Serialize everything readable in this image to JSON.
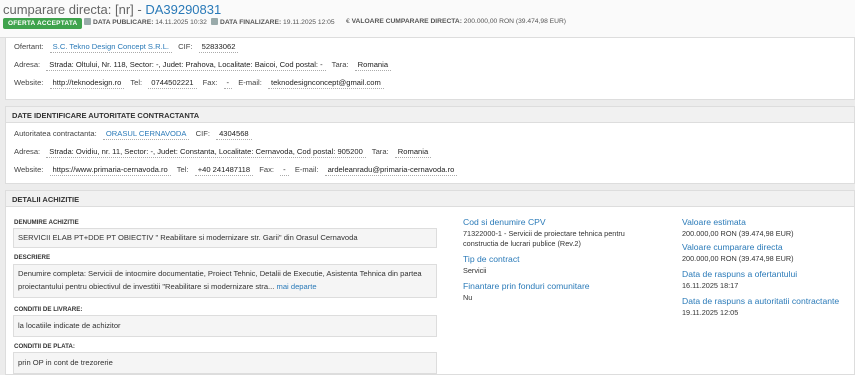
{
  "header": {
    "title_prefix": "cumparare directa: [nr] - ",
    "title_code": "DA39290831",
    "status_badge": "OFERTA ACCEPTATA",
    "publish_label": "DATA PUBLICARE:",
    "publish_value": "14.11.2025 10:32",
    "finalize_label": "DATA FINALIZARE:",
    "finalize_value": "19.11.2025 12:05",
    "value_label": "VALOARE CUMPARARE DIRECTA:",
    "value_value": "200.000,00 RON (39.474,98 EUR)",
    "value_currency_symbol": "€"
  },
  "offerer": {
    "ofertant_label": "Ofertant:",
    "ofertant_value": "S.C. Tekno Design Concept S.R.L.",
    "cif_label": "CIF:",
    "cif_value": "52833062",
    "address_label": "Adresa:",
    "address_value": "Strada: Oltului, Nr. 118, Sector: -, Judet: Prahova, Localitate: Baicoi, Cod postal: -",
    "country_label": "Tara:",
    "country_value": "Romania",
    "website_label": "Website:",
    "website_value": "http://teknodesign.ro",
    "tel_label": "Tel:",
    "tel_value": "0744502221",
    "fax_label": "Fax:",
    "fax_value": "-",
    "email_label": "E-mail:",
    "email_value": "teknodesignconcept@gmail.com"
  },
  "authority": {
    "section_title": "DATE IDENTIFICARE AUTORITATE CONTRACTANTA",
    "name_label": "Autoritatea contractanta:",
    "name_value": "ORASUL CERNAVODA",
    "cif_label": "CIF:",
    "cif_value": "4304568",
    "address_label": "Adresa:",
    "address_value": "Strada: Ovidiu, nr. 11, Sector: -, Judet: Constanta, Localitate: Cernavoda, Cod postal: 905200",
    "country_label": "Tara:",
    "country_value": "Romania",
    "website_label": "Website:",
    "website_value": "https://www.primaria-cernavoda.ro",
    "tel_label": "Tel:",
    "tel_value": "+40 241487118",
    "fax_label": "Fax:",
    "fax_value": "-",
    "email_label": "E-mail:",
    "email_value": "ardeleanradu@primaria-cernavoda.ro"
  },
  "details": {
    "section_title": "DETALII ACHIZITIE",
    "denumire_label": "DENUMIRE ACHIZITIE",
    "denumire_value": "SERVICII ELAB PT+DDE PT OBIECTIV \" Reabilitare si modernizare str. Garii\" din Orasul Cernavoda",
    "descriere_label": "DESCRIERE",
    "descriere_value": "Denumire completa: Servicii de intocmire documentatie, Proiect Tehnic, Detalii de Executie, Asistenta Tehnica din partea proiectantului pentru obiectivul de investitii \"Reabilitare si modernizare stra...",
    "descriere_more": "mai departe",
    "livrare_label": "CONDITII DE LIVRARE:",
    "livrare_value": "la locatiile indicate de achizitor",
    "plata_label": "CONDITII DE PLATA:",
    "plata_value": "prin OP in cont de trezorerie",
    "cpv_title": "Cod si denumire CPV",
    "cpv_value_1": "71322000-1 - Servicii de proiectare tehnica pentru",
    "cpv_value_2": "constructia de lucrari publice (Rev.2)",
    "contract_title": "Tip de contract",
    "contract_value": "Servicii",
    "finantare_title": "Finantare prin fonduri comunitare",
    "finantare_value": "Nu",
    "estimata_title": "Valoare estimata",
    "estimata_value": "200.000,00 RON (39.474,98 EUR)",
    "cumparare_title": "Valoare cumparare directa",
    "cumparare_value": "200.000,00 RON (39.474,98 EUR)",
    "rasp_ofertant_title": "Data de raspuns a ofertantului",
    "rasp_ofertant_value": "16.11.2025 18:17",
    "rasp_autoritate_title": "Data de raspuns a autoritatii contractante",
    "rasp_autoritate_value": "19.11.2025 12:05"
  },
  "colors": {
    "accent": "#2a7ab8",
    "badge": "#3fa34d"
  }
}
